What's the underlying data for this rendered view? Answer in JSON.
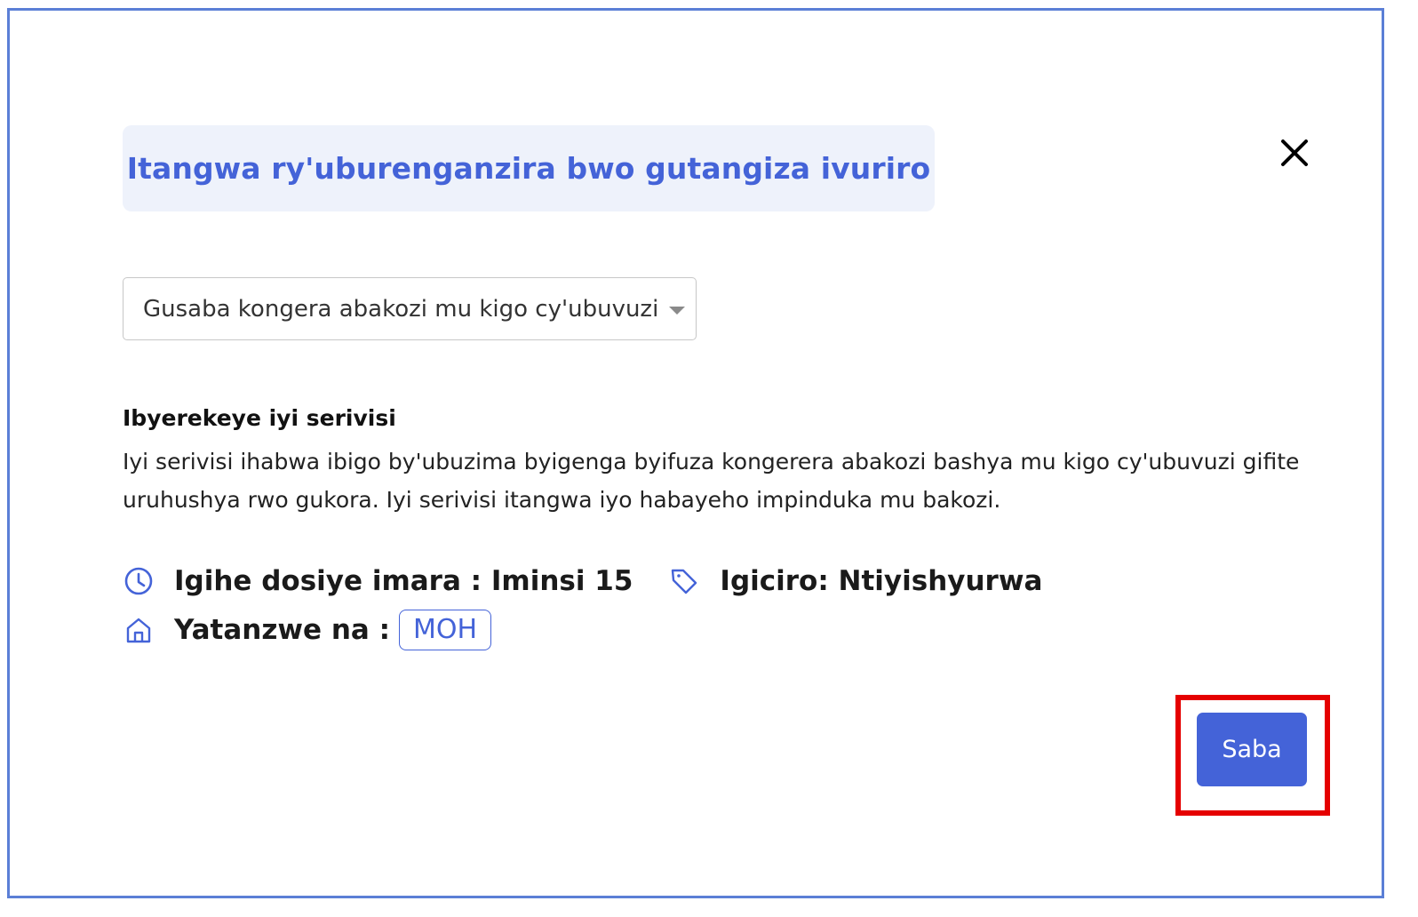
{
  "modal": {
    "title": "Itangwa ry'uburenganzira bwo gutangiza ivuriro",
    "close_icon": "close-icon"
  },
  "service_select": {
    "selected_value": "Gusaba kongera abakozi mu kigo cy'ubuvuzi"
  },
  "about": {
    "heading": "Ibyerekeye iyi serivisi",
    "body": "Iyi serivisi ihabwa ibigo by'ubuzima byigenga byifuza kongerera abakozi bashya mu kigo cy'ubuvuzi gifite uruhushya rwo gukora. Iyi serivisi itangwa iyo habayeho impinduka mu bakozi."
  },
  "meta": {
    "duration": "Igihe dosiye imara : Iminsi 15",
    "price": "Igiciro: Ntiyishyurwa",
    "provider_label": "Yatanzwe na :",
    "provider_badge": "MOH",
    "icons": {
      "duration": "clock-icon",
      "price": "tag-icon",
      "provider": "home-icon"
    }
  },
  "actions": {
    "submit_label": "Saba"
  },
  "colors": {
    "accent": "#4463d8",
    "title_bg": "#eef2fb",
    "frame_border": "#5b7fd6",
    "highlight": "#e50000"
  }
}
